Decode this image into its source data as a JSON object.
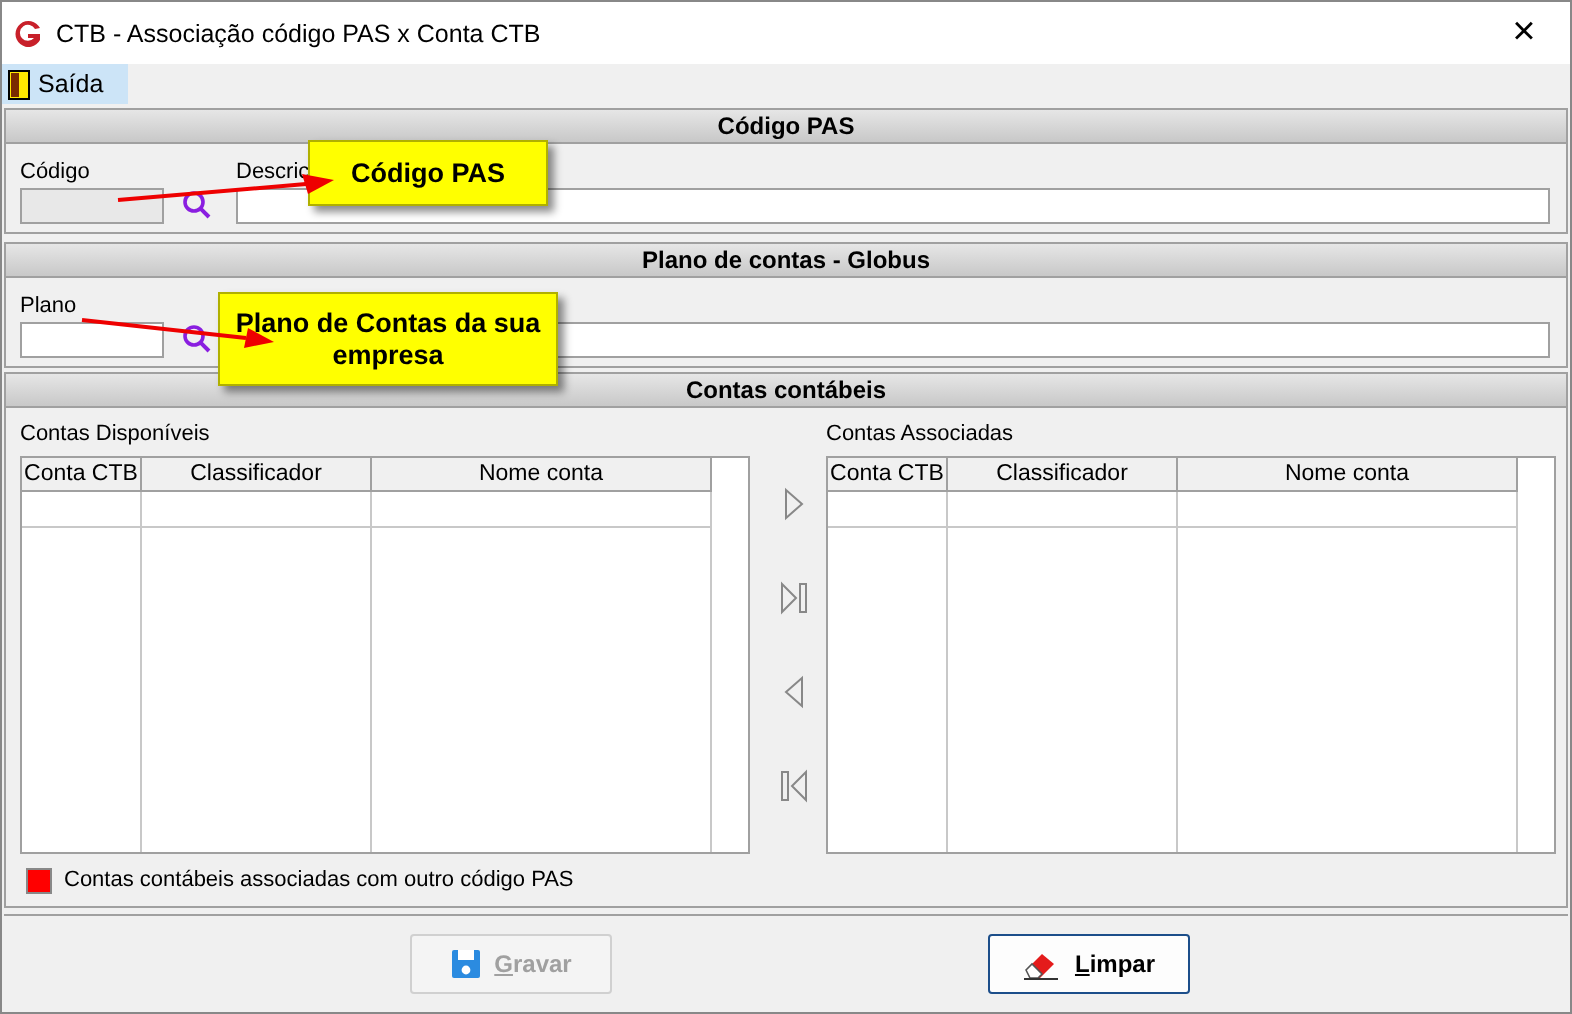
{
  "window": {
    "title": "CTB - Associação código PAS x Conta CTB",
    "close": "×"
  },
  "menu": [
    {
      "label": "Saída",
      "selected": true
    }
  ],
  "codigo_pas": {
    "header": "Código PAS",
    "code_label": "Código",
    "code_disabled": true,
    "description_label": "Descric"
  },
  "plano": {
    "header": "Plano de contas - Globus",
    "code_label": "Plano",
    "code_disabled": false
  },
  "contas": {
    "header": "Contas contábeis",
    "available": {
      "label": "Contas Disponíveis",
      "columns": [
        "Conta CTB",
        "Classificador",
        "Nome conta"
      ]
    },
    "associated": {
      "label": "Contas Associadas",
      "columns": [
        "Conta CTB",
        "Classificador",
        "Nome conta"
      ]
    },
    "legend": {
      "color": "#ff0000",
      "text": "Contas contábeis associadas com outro código PAS"
    }
  },
  "buttons": [
    {
      "label": "Gravar",
      "kind": "save",
      "disabled": true
    },
    {
      "label": "Limpar",
      "kind": "clear",
      "disabled": false
    }
  ],
  "callouts": [
    {
      "text": "Código PAS"
    },
    {
      "text": "Plano de Contas da sua empresa"
    }
  ]
}
